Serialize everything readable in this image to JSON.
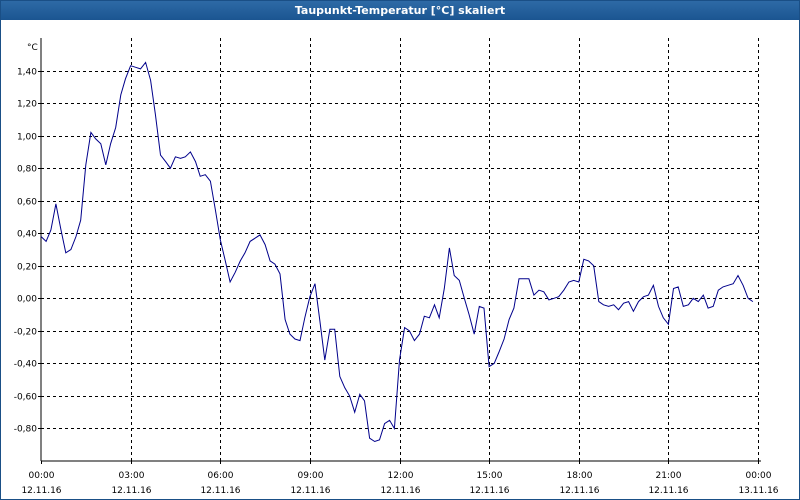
{
  "window": {
    "title": "Taupunkt-Temperatur [°C] skaliert"
  },
  "chart_data": {
    "type": "line",
    "title": "Taupunkt-Temperatur [°C] skaliert",
    "ylabel": "°C",
    "xlabel": "",
    "ylim": [
      -1.0,
      1.6
    ],
    "xlim": [
      0,
      24
    ],
    "grid": true,
    "line_color": "#00008b",
    "yticks": [
      -0.8,
      -0.6,
      -0.4,
      -0.2,
      0.0,
      0.2,
      0.4,
      0.6,
      0.8,
      1.0,
      1.2,
      1.4
    ],
    "ytick_labels": [
      "-0,80",
      "-0,60",
      "-0,40",
      "-0,20",
      "0,00",
      "0,20",
      "0,40",
      "0,60",
      "0,80",
      "1,00",
      "1,20",
      "1,40"
    ],
    "xticks": [
      0,
      3,
      6,
      9,
      12,
      15,
      18,
      21,
      24
    ],
    "xtick_labels": [
      {
        "time": "00:00",
        "date": "12.11.16"
      },
      {
        "time": "03:00",
        "date": "12.11.16"
      },
      {
        "time": "06:00",
        "date": "12.11.16"
      },
      {
        "time": "09:00",
        "date": "12.11.16"
      },
      {
        "time": "12:00",
        "date": "12.11.16"
      },
      {
        "time": "15:00",
        "date": "12.11.16"
      },
      {
        "time": "18:00",
        "date": "12.11.16"
      },
      {
        "time": "21:00",
        "date": "12.11.16"
      },
      {
        "time": "00:00",
        "date": "13.11.16"
      }
    ],
    "series": [
      {
        "x": [
          0.0,
          0.17,
          0.33,
          0.5,
          0.67,
          0.83,
          1.0,
          1.17,
          1.33,
          1.5,
          1.67,
          1.83,
          2.0,
          2.17,
          2.33,
          2.5,
          2.67,
          2.83,
          3.0,
          3.17,
          3.33,
          3.5,
          3.67,
          3.83,
          4.0,
          4.17,
          4.33,
          4.5,
          4.67,
          4.83,
          5.0,
          5.17,
          5.33,
          5.5,
          5.67,
          5.83,
          6.0,
          6.17,
          6.33,
          6.5,
          6.67,
          6.83,
          7.0,
          7.17,
          7.33,
          7.5,
          7.67,
          7.83,
          8.0,
          8.17,
          8.33,
          8.5,
          8.67,
          8.83,
          9.0,
          9.17,
          9.33,
          9.5,
          9.67,
          9.83,
          10.0,
          10.17,
          10.33,
          10.5,
          10.67,
          10.83,
          11.0,
          11.17,
          11.33,
          11.5,
          11.67,
          11.83,
          12.0,
          12.17,
          12.33,
          12.5,
          12.67,
          12.83,
          13.0,
          13.17,
          13.33,
          13.5,
          13.67,
          13.83,
          14.0,
          14.17,
          14.33,
          14.5,
          14.67,
          14.83,
          15.0,
          15.17,
          15.33,
          15.5,
          15.67,
          15.83,
          16.0,
          16.17,
          16.33,
          16.5,
          16.67,
          16.83,
          17.0,
          17.17,
          17.33,
          17.5,
          17.67,
          17.83,
          18.0,
          18.17,
          18.33,
          18.5,
          18.67,
          18.83,
          19.0,
          19.17,
          19.33,
          19.5,
          19.67,
          19.83,
          20.0,
          20.17,
          20.33,
          20.5,
          20.67,
          20.83,
          21.0,
          21.17,
          21.33,
          21.5,
          21.67,
          21.83,
          22.0,
          22.17,
          22.33,
          22.5,
          22.67,
          22.83,
          23.0,
          23.17,
          23.33,
          23.5,
          23.67,
          23.83
        ],
        "values": [
          0.38,
          0.35,
          0.42,
          0.58,
          0.42,
          0.28,
          0.3,
          0.38,
          0.48,
          0.82,
          1.02,
          0.98,
          0.95,
          0.82,
          0.95,
          1.05,
          1.25,
          1.35,
          1.43,
          1.42,
          1.41,
          1.45,
          1.34,
          1.13,
          0.88,
          0.84,
          0.8,
          0.87,
          0.86,
          0.87,
          0.9,
          0.84,
          0.75,
          0.76,
          0.72,
          0.55,
          0.36,
          0.23,
          0.1,
          0.16,
          0.23,
          0.28,
          0.35,
          0.37,
          0.39,
          0.33,
          0.23,
          0.21,
          0.15,
          -0.13,
          -0.22,
          -0.25,
          -0.26,
          -0.12,
          0.01,
          0.09,
          -0.13,
          -0.38,
          -0.19,
          -0.19,
          -0.48,
          -0.55,
          -0.6,
          -0.7,
          -0.59,
          -0.63,
          -0.86,
          -0.88,
          -0.87,
          -0.77,
          -0.75,
          -0.8,
          -0.38,
          -0.18,
          -0.2,
          -0.26,
          -0.22,
          -0.11,
          -0.12,
          -0.04,
          -0.12,
          0.06,
          0.31,
          0.14,
          0.11,
          0.0,
          -0.1,
          -0.22,
          -0.05,
          -0.06,
          -0.42,
          -0.4,
          -0.33,
          -0.25,
          -0.13,
          -0.06,
          0.12,
          0.12,
          0.12,
          0.02,
          0.05,
          0.04,
          -0.01,
          0.0,
          0.01,
          0.05,
          0.1,
          0.11,
          0.1,
          0.24,
          0.23,
          0.2,
          -0.02,
          -0.04,
          -0.05,
          -0.04,
          -0.07,
          -0.03,
          -0.02,
          -0.08,
          -0.02,
          0.01,
          0.02,
          0.08,
          -0.05,
          -0.12,
          -0.16,
          0.06,
          0.07,
          -0.05,
          -0.04,
          0.0,
          -0.02,
          0.02,
          -0.06,
          -0.05,
          0.05,
          0.07,
          0.08,
          0.09,
          0.14,
          0.08,
          0.0,
          -0.02
        ]
      }
    ]
  }
}
